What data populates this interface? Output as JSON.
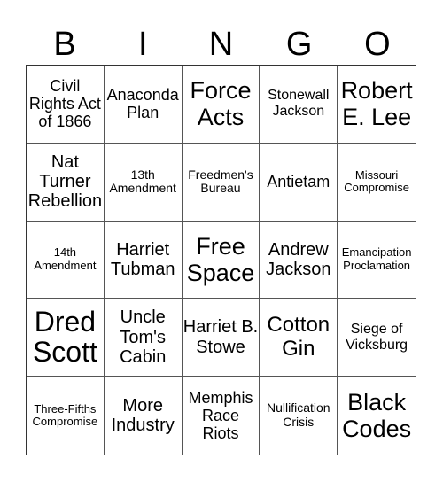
{
  "header": [
    "B",
    "I",
    "N",
    "G",
    "O"
  ],
  "cells": [
    "Civil Rights Act of 1866",
    "Anaconda Plan",
    "Force Acts",
    "Stonewall Jackson",
    "Robert E. Lee",
    "Nat Turner Rebellion",
    "13th Amendment",
    "Freedmen's Bureau",
    "Antietam",
    "Missouri Compromise",
    "14th Amendment",
    "Harriet Tubman",
    "Free Space",
    "Andrew Jackson",
    "Emancipation Proclamation",
    "Dred Scott",
    "Uncle Tom's Cabin",
    "Harriet B. Stowe",
    "Cotton Gin",
    "Siege of Vicksburg",
    "Three-Fifths Compromise",
    "More Industry",
    "Memphis Race Riots",
    "Nullification Crisis",
    "Black Codes"
  ]
}
